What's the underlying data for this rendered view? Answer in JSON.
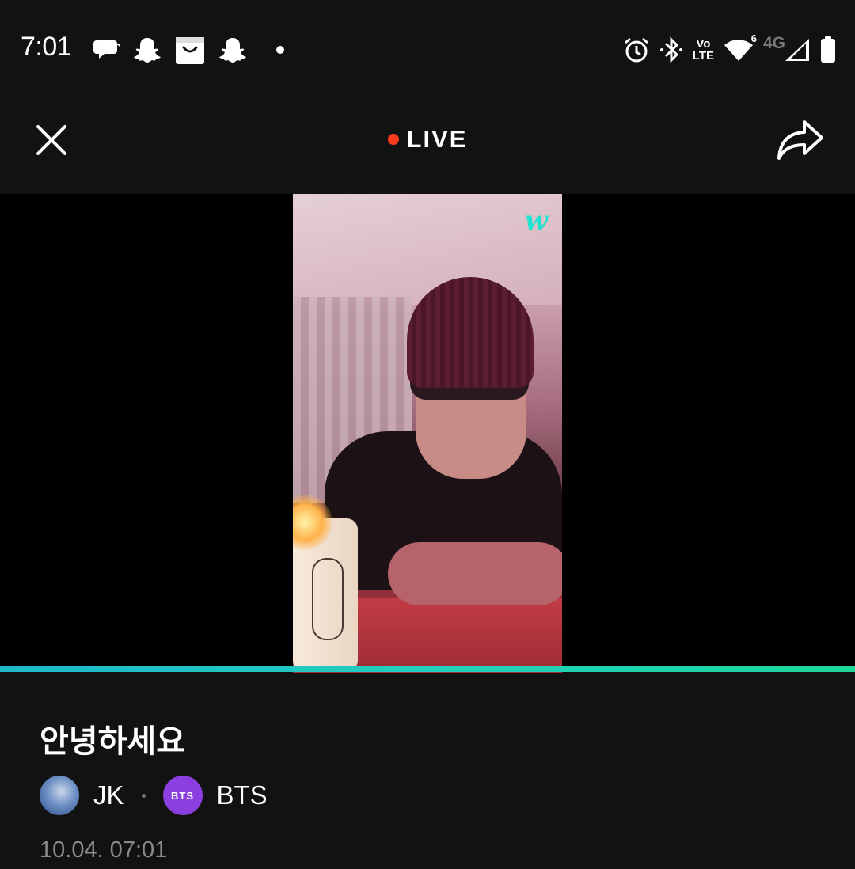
{
  "status_bar": {
    "time": "7:01",
    "network_label": "4G",
    "volte_top": "Vo",
    "volte_bottom": "LTE",
    "wifi_badge": "6",
    "left_icons": [
      "chat-icon",
      "snapchat-icon",
      "shopping-bag-icon",
      "snapchat-icon",
      "dot-icon"
    ],
    "right_icons": [
      "alarm-icon",
      "bluetooth-icon",
      "volte-icon",
      "wifi-icon",
      "signal-icon",
      "battery-icon"
    ]
  },
  "header": {
    "live_label": "LIVE",
    "close_icon": "close-icon",
    "share_icon": "share-icon",
    "live_color": "#ff3b1f"
  },
  "video": {
    "watermark": "w",
    "accent_color": "#1de4d1"
  },
  "broadcast": {
    "title": "안녕하세요",
    "artist_name": "JK",
    "channel_badge": "BTS",
    "channel_name": "BTS",
    "datetime": "10.04. 07:01"
  }
}
